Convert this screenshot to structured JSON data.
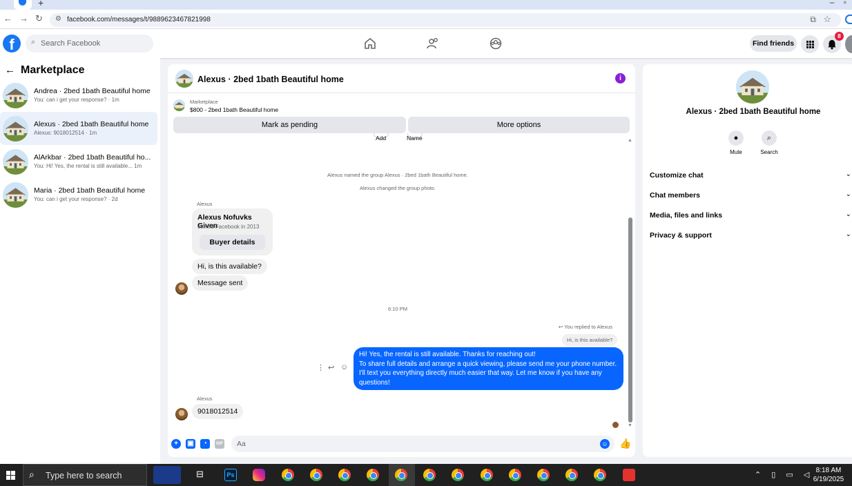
{
  "browser": {
    "url": "facebook.com/messages/t/9889623467821998"
  },
  "header": {
    "search_placeholder": "Search Facebook",
    "find_friends": "Find friends",
    "notification_count": "8"
  },
  "marketplace": {
    "title": "Marketplace",
    "conversations": [
      {
        "name": "Andrea · 2bed 1bath Beautiful home",
        "preview": "You: can i get your response? · 1m",
        "active": false
      },
      {
        "name": "Alexus · 2bed 1bath Beautiful home",
        "preview": "Alexus: 9018012514 · 1m",
        "active": true
      },
      {
        "name": "AlArkbar · 2bed 1bath Beautiful ho...",
        "preview": "You: Hi! Yes, the rental is still available... 1m",
        "active": false
      },
      {
        "name": "Maria · 2bed 1bath Beautiful home",
        "preview": "You: can i get your response? · 2d",
        "active": false
      }
    ]
  },
  "chat": {
    "title": "Alexus · 2bed 1bath Beautiful home",
    "marketplace_label": "Marketplace",
    "listing": "$800 - 2bed 1bath Beautiful home",
    "mark_pending": "Mark as pending",
    "more_options": "More options",
    "top_actions": [
      "Add",
      "Name"
    ],
    "system_messages": [
      "Alexus named the group Alexus · 2bed 1bath Beautiful home.",
      "Alexus changed the group photo."
    ],
    "sender_name": "Alexus",
    "buyer_card": {
      "name": "Alexus Nofuvks Given",
      "joined": "Joined Facebook in 2013",
      "button": "Buyer details"
    },
    "incoming_1": "Hi, is this available?",
    "incoming_2": "Message sent",
    "timestamp": "6:10 PM",
    "replied_label": "You replied to Alexus",
    "quoted": "Hi, is this available?",
    "outgoing": [
      "Hi! Yes, the rental is still available. Thanks for reaching out!",
      "To share full details and arrange a quick viewing, please send me your phone number. I'll text you everything directly much easier that way. Let me know if you have any questions!"
    ],
    "incoming_3": "9018012514",
    "composer_placeholder": "Aa"
  },
  "details": {
    "title": "Alexus · 2bed 1bath Beautiful home",
    "actions": [
      "Mute",
      "Search"
    ],
    "sections": [
      "Customize chat",
      "Chat members",
      "Media, files and links",
      "Privacy & support"
    ]
  },
  "taskbar": {
    "search_placeholder": "Type here to search",
    "time": "8:18 AM",
    "date": "6/19/2025"
  }
}
